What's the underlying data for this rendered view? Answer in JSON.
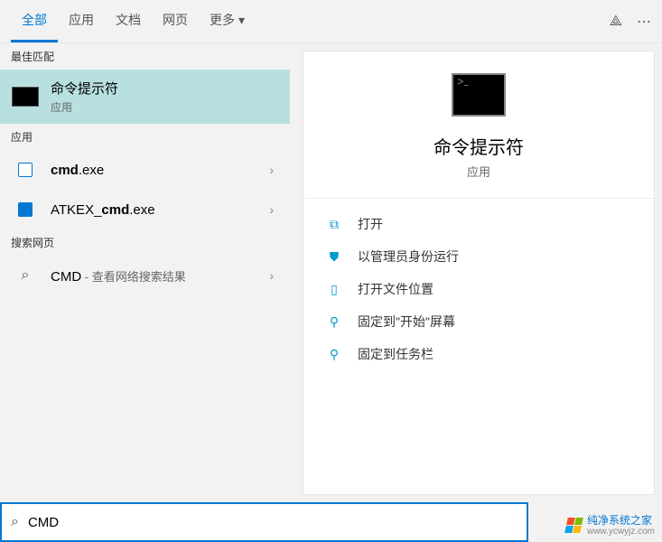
{
  "tabs": {
    "all": "全部",
    "apps": "应用",
    "docs": "文档",
    "web": "网页",
    "more": "更多"
  },
  "sections": {
    "best_match": "最佳匹配",
    "apps": "应用",
    "search_web": "搜索网页"
  },
  "results": {
    "best": {
      "title": "命令提示符",
      "sub": "应用"
    },
    "apps": [
      {
        "title_prefix": "",
        "title_bold": "cmd",
        "title_suffix": ".exe"
      },
      {
        "title_prefix": "ATKEX_",
        "title_bold": "cmd",
        "title_suffix": ".exe"
      }
    ],
    "web": {
      "title": "CMD",
      "sub": " - 查看网络搜索结果"
    }
  },
  "detail": {
    "title": "命令提示符",
    "sub": "应用",
    "actions": [
      "打开",
      "以管理员身份运行",
      "打开文件位置",
      "固定到\"开始\"屏幕",
      "固定到任务栏"
    ]
  },
  "search": {
    "value": "CMD"
  },
  "watermark": {
    "line1": "纯净系统之家",
    "line2": "www.ycwyjz.com"
  }
}
